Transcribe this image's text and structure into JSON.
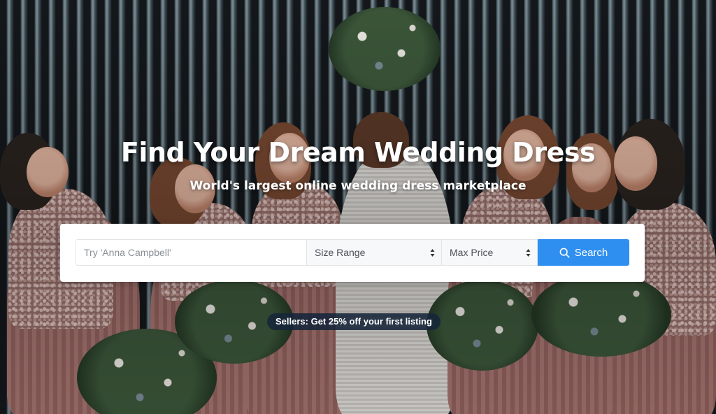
{
  "hero": {
    "headline": "Find Your Dream Wedding Dress",
    "subheadline": "World's largest online wedding dress marketplace"
  },
  "search": {
    "query_placeholder": "Try 'Anna Campbell'",
    "query_value": "",
    "size_label": "Size Range",
    "price_label": "Max Price",
    "button_label": "Search",
    "button_icon": "search-icon",
    "button_color": "#2f8ff0"
  },
  "promo": {
    "label": "Sellers: Get 25% off your first listing"
  }
}
